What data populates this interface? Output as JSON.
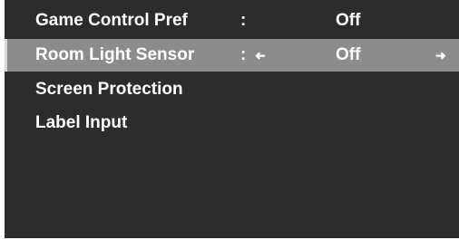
{
  "menu": {
    "items": [
      {
        "label": "Game Control Pref",
        "separator": ":",
        "value": "Off"
      },
      {
        "label": "Room Light Sensor",
        "separator": ":",
        "value": "Off",
        "selected": true,
        "left_arrow": "left-arrow-icon",
        "right_arrow": "right-arrow-icon"
      },
      {
        "label": "Screen Protection"
      },
      {
        "label": "Label Input"
      }
    ]
  },
  "colors": {
    "background": "#2c2c2c",
    "selected_row": "#8c8c8c",
    "text": "#ffffff"
  }
}
